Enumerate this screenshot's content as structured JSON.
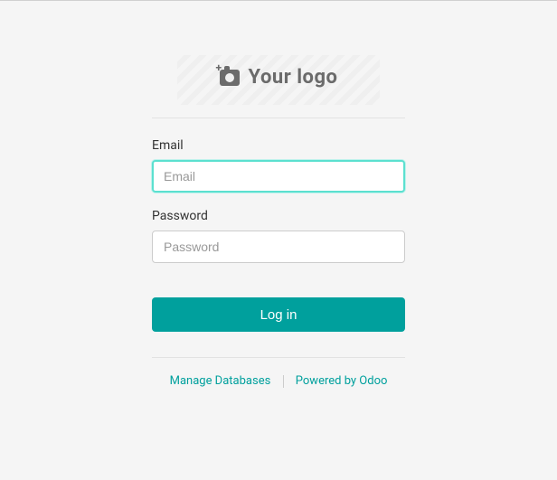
{
  "logo": {
    "text": "Your logo"
  },
  "form": {
    "email": {
      "label": "Email",
      "placeholder": "Email",
      "value": ""
    },
    "password": {
      "label": "Password",
      "placeholder": "Password",
      "value": ""
    },
    "submit_label": "Log in"
  },
  "footer": {
    "manage_db": "Manage Databases",
    "powered_by": "Powered by Odoo"
  },
  "colors": {
    "accent": "#00a09d",
    "focus": "#5ce0d0"
  }
}
